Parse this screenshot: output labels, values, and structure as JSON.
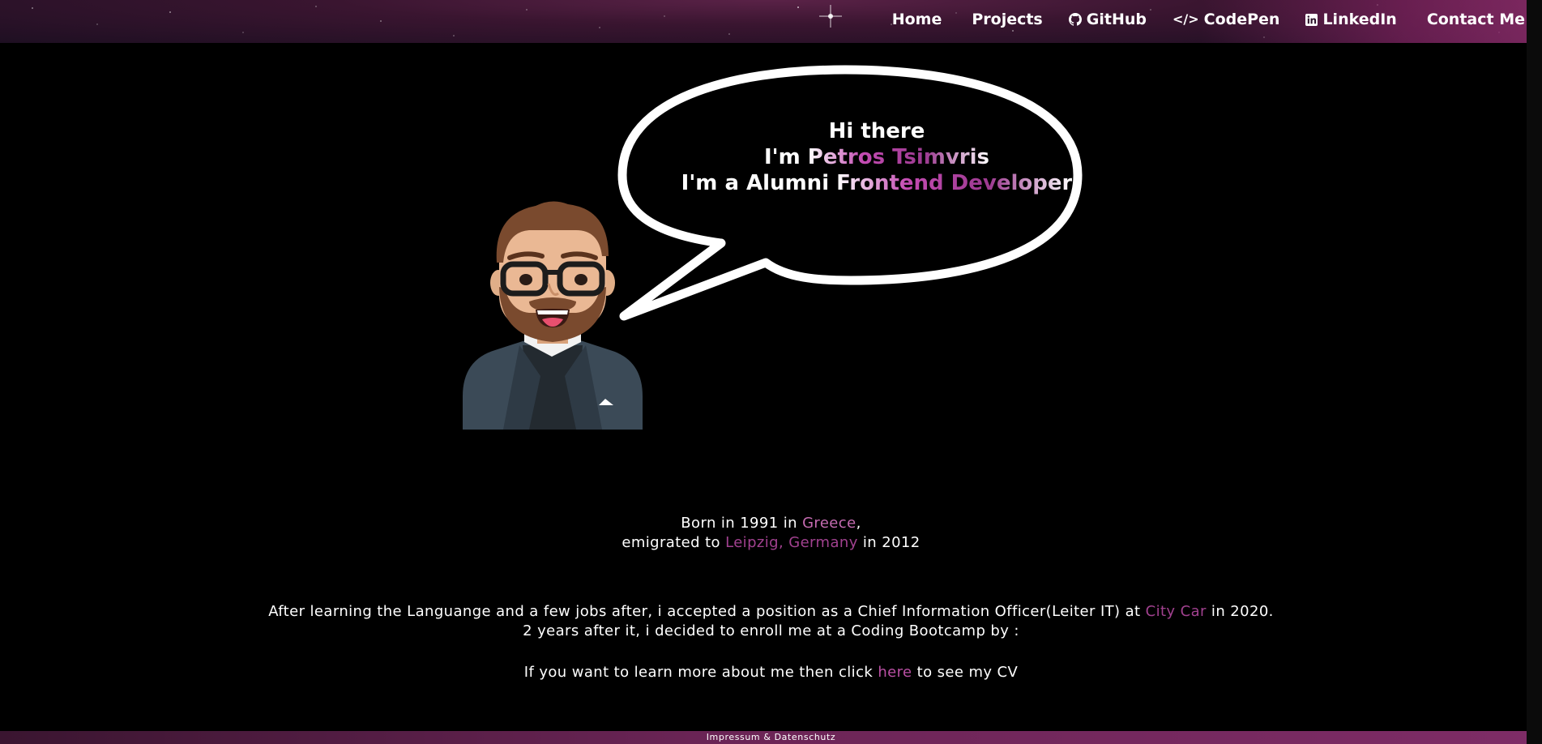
{
  "nav": {
    "home": "Home",
    "projects": "Projects",
    "github": "GitHub",
    "codepen": "CodePen",
    "linkedin": "LinkedIn",
    "contact": "Contact Me"
  },
  "hero": {
    "line1": "Hi there",
    "line2_prefix": "I'm ",
    "line2_name": "Petros Tsimvris",
    "line3_prefix": "I'm a Alumni ",
    "line3_role": "Frontend Developer"
  },
  "bio": {
    "born_prefix": "Born in 1991 in ",
    "born_country": "Greece",
    "born_suffix": ",",
    "emigrated_prefix": "emigrated to ",
    "emigrated_place": "Leipzig, Germany",
    "emigrated_suffix": " in 2012",
    "career_prefix": "After learning the Languange and a few jobs after, i accepted a position as a Chief Information Officer(Leiter IT) at ",
    "career_company": "City Car",
    "career_suffix": " in 2020.",
    "bootcamp": "2 years after it, i decided to enroll me at a Coding Bootcamp by :",
    "cv_prefix": "If you want to learn more about me then click ",
    "cv_link": "here",
    "cv_suffix": " to see my CV"
  },
  "footer": {
    "link": "Impressum & Datenschutz"
  },
  "colors": {
    "accent_light": "#c56bb1",
    "accent_dark": "#a1418f",
    "background": "#000000"
  }
}
